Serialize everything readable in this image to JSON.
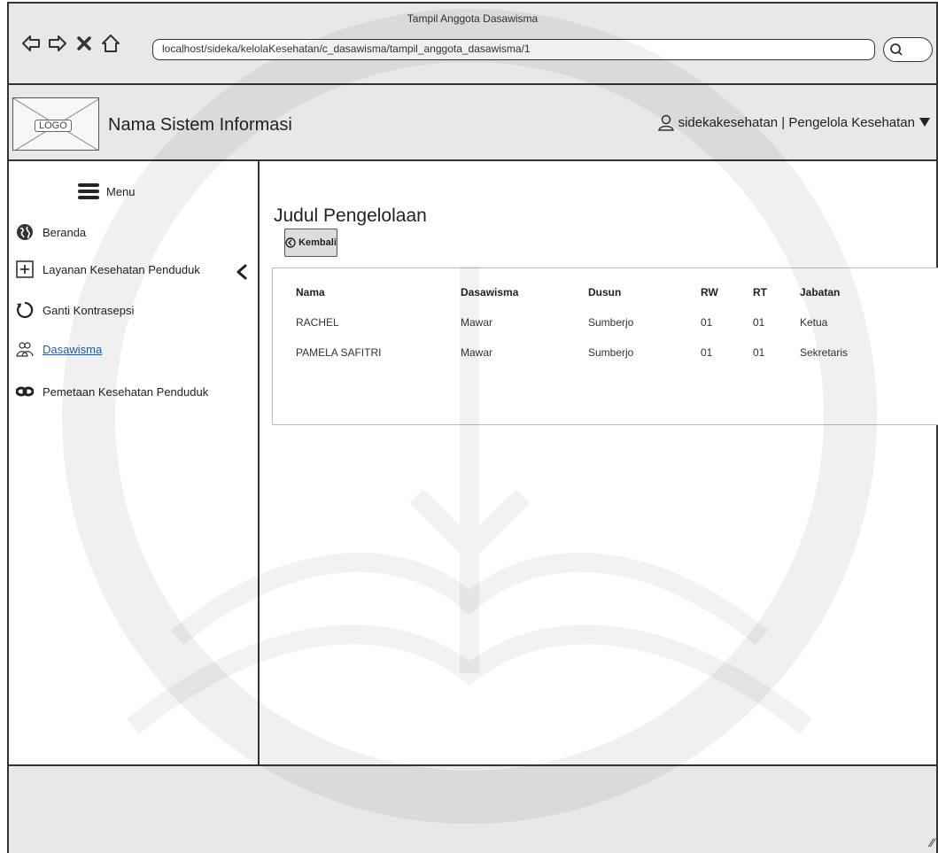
{
  "window": {
    "title": "Tampil Anggota Dasawisma"
  },
  "browser": {
    "url": "localhost/sideka/kelolaKesehatan/c_dasawisma/tampil_anggota_dasawisma/1",
    "icons": [
      "back-arrow-icon",
      "forward-arrow-icon",
      "close-icon",
      "home-icon",
      "search-icon"
    ]
  },
  "header": {
    "logo_text": "LOGO",
    "system_name": "Nama Sistem Informasi",
    "user_label": "sidekakesehatan | Pengelola Kesehatan"
  },
  "sidebar": {
    "menu_label": "Menu",
    "items": [
      {
        "label": "Beranda",
        "icon": "globe-icon"
      },
      {
        "label": "Layanan Kesehatan Penduduk",
        "icon": "plus-box-icon"
      },
      {
        "label": "Ganti Kontrasepsi",
        "icon": "refresh-icon"
      },
      {
        "label": "Dasawisma",
        "icon": "users-icon",
        "active": true
      },
      {
        "label": "Pemetaan Kesehatan Penduduk",
        "icon": "link-icon"
      }
    ]
  },
  "main": {
    "page_title": "Judul Pengelolaan",
    "back_button_label": "Kembali",
    "table": {
      "columns": [
        "Nama",
        "Dasawisma",
        "Dusun",
        "RW",
        "RT",
        "Jabatan"
      ],
      "rows": [
        [
          "RACHEL",
          "Mawar",
          "Sumberjo",
          "01",
          "01",
          "Ketua"
        ],
        [
          "PAMELA SAFITRI",
          "Mawar",
          "Sumberjo",
          "01",
          "01",
          "Sekretaris"
        ]
      ]
    }
  },
  "colors": {
    "chrome_bg": "#e8e8e8",
    "link": "#2a5db0",
    "border": "#333333"
  }
}
